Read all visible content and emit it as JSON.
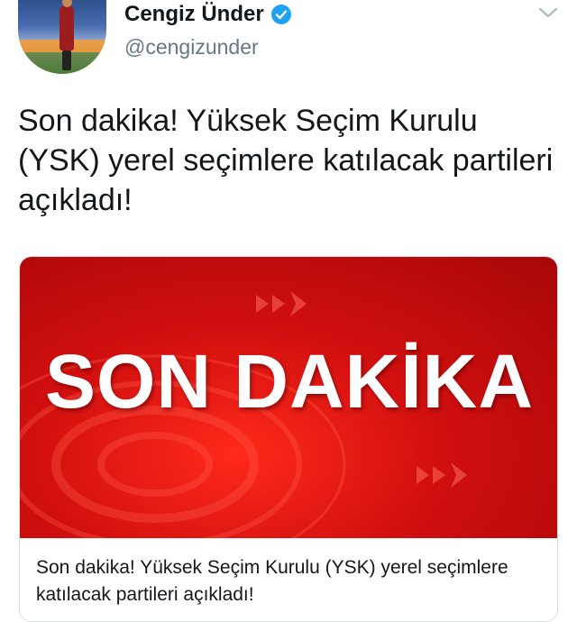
{
  "author": {
    "display_name": "Cengiz Ünder",
    "handle": "@cengizunder",
    "verified": true
  },
  "tweet": {
    "text": "Son dakika! Yüksek Seçim Kurulu (YSK) yerel seçimlere katılacak partileri açıkladı!"
  },
  "card": {
    "image_headline": "SON DAKİKA",
    "title": "Son dakika! Yüksek Seçim Kurulu (YSK) yerel seçimlere katılacak partileri açıkladı!"
  },
  "icons": {
    "verified": "verified-badge-icon",
    "menu": "chevron-down-icon"
  },
  "colors": {
    "accent": "#1da1f2",
    "card_red": "#d10f0f",
    "handle": "#657786"
  }
}
